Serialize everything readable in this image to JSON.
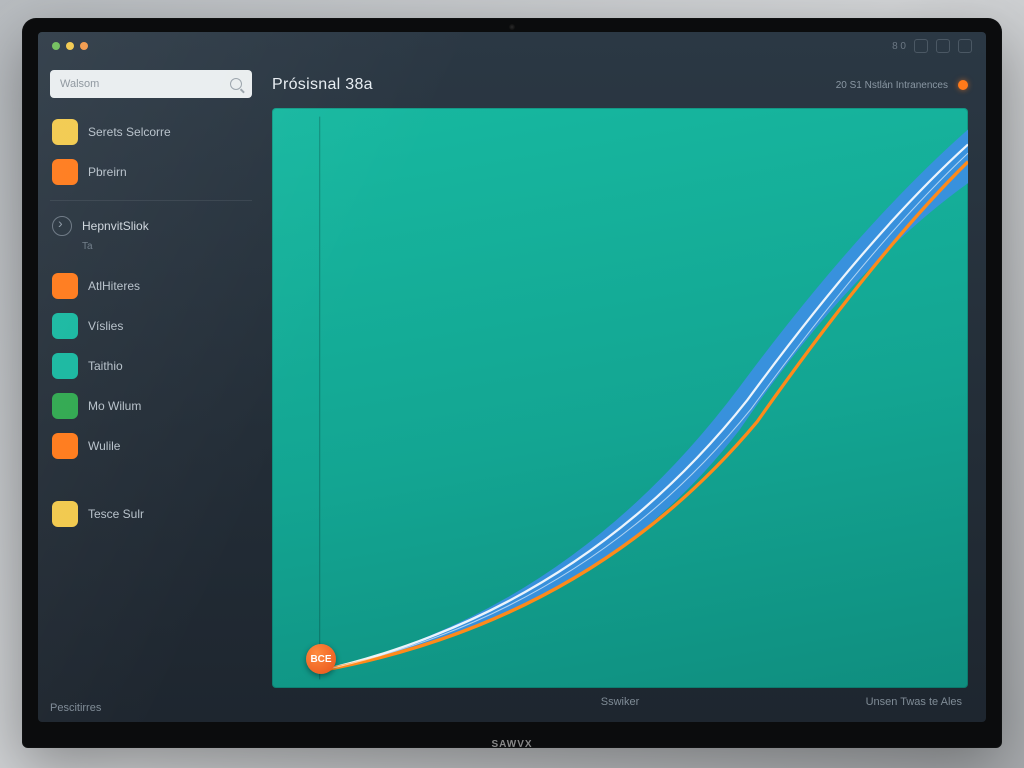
{
  "device": {
    "brand": "SAWVX"
  },
  "topbar": {
    "dot_colors": [
      "#6fbf5a",
      "#f2c94c",
      "#f2994a"
    ],
    "right_label": "8  0"
  },
  "search": {
    "placeholder": "Walsom"
  },
  "sidebar": {
    "primary": [
      {
        "label": "Serets Selcorre",
        "color": "#f2c94c"
      },
      {
        "label": "Pbreirn",
        "color": "#ff7a1a"
      }
    ],
    "section": {
      "label": "HepnvitSliok",
      "sub": "Ta"
    },
    "apps": [
      {
        "label": "AtlHiteres",
        "color": "#ff7a1a"
      },
      {
        "label": "Víslies",
        "color": "#17b8a0"
      },
      {
        "label": "Taithio",
        "color": "#17b8a0"
      },
      {
        "label": "Mo Wilum",
        "color": "#2fa84f"
      },
      {
        "label": "Wulile",
        "color": "#ff7a1a"
      }
    ],
    "extra": {
      "label": "Tesce Sulr",
      "color": "#f2c94c"
    },
    "footer": {
      "label": "Pescitirres"
    }
  },
  "main": {
    "title": "Prósisnal 38a",
    "status_text": "20 S1 Nstlán Intranences",
    "marker_label": "BCE",
    "footer_center": "Sswiker",
    "footer_right": "Unsen Twas te Ales"
  },
  "chart_data": {
    "type": "line",
    "title": "Prósisnal 38a",
    "xlabel": "",
    "ylabel": "",
    "xlim": [
      0,
      100
    ],
    "ylim": [
      0,
      100
    ],
    "series": [
      {
        "name": "blue",
        "color": "#3a8fe0",
        "x": [
          8,
          20,
          35,
          50,
          65,
          80,
          95,
          100
        ],
        "y": [
          2,
          8,
          20,
          38,
          56,
          74,
          90,
          98
        ]
      },
      {
        "name": "white",
        "color": "#ffffff",
        "x": [
          8,
          20,
          35,
          50,
          65,
          80,
          95,
          100
        ],
        "y": [
          2,
          6,
          16,
          32,
          50,
          68,
          85,
          94
        ]
      },
      {
        "name": "orange",
        "color": "#ff8a1a",
        "x": [
          8,
          20,
          35,
          50,
          65,
          80,
          95,
          100
        ],
        "y": [
          2,
          5,
          14,
          28,
          46,
          64,
          82,
          92
        ]
      }
    ],
    "annotations": [
      {
        "text": "BCE",
        "x": 8,
        "y": 2,
        "color": "#e8531a"
      }
    ]
  }
}
